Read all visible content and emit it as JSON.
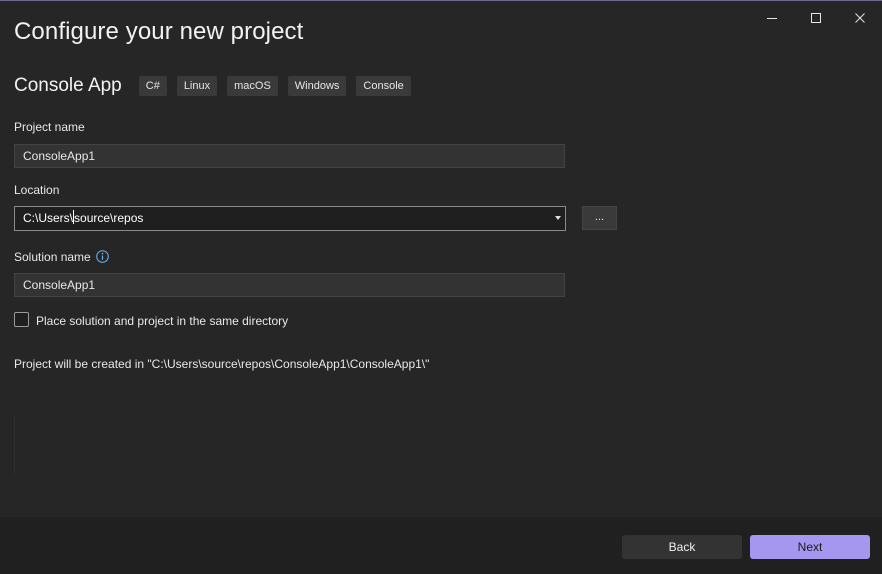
{
  "window": {
    "title": "Configure your new project",
    "controls": [
      "minimize-icon",
      "maximize-icon",
      "close-icon"
    ]
  },
  "template": {
    "name": "Console App",
    "tags": [
      "C#",
      "Linux",
      "macOS",
      "Windows",
      "Console"
    ]
  },
  "form": {
    "project_name_label": "Project name",
    "project_name_value": "ConsoleApp1",
    "location_label": "Location",
    "location_value_before_caret": "C:\\Users\\",
    "location_value_after_caret": "source\\repos",
    "browse_label": "...",
    "solution_name_label": "Solution name",
    "solution_name_value": "ConsoleApp1",
    "same_directory_label": "Place solution and project in the same directory",
    "same_directory_checked": false,
    "path_info": "Project will be created in \"C:\\Users\\source\\repos\\ConsoleApp1\\ConsoleApp1\\\""
  },
  "footer": {
    "back_label": "Back",
    "next_label": "Next"
  },
  "colors": {
    "background": "#262626",
    "footer": "#202020",
    "accent": "#a596f0",
    "info_icon": "#6cb4f0"
  }
}
